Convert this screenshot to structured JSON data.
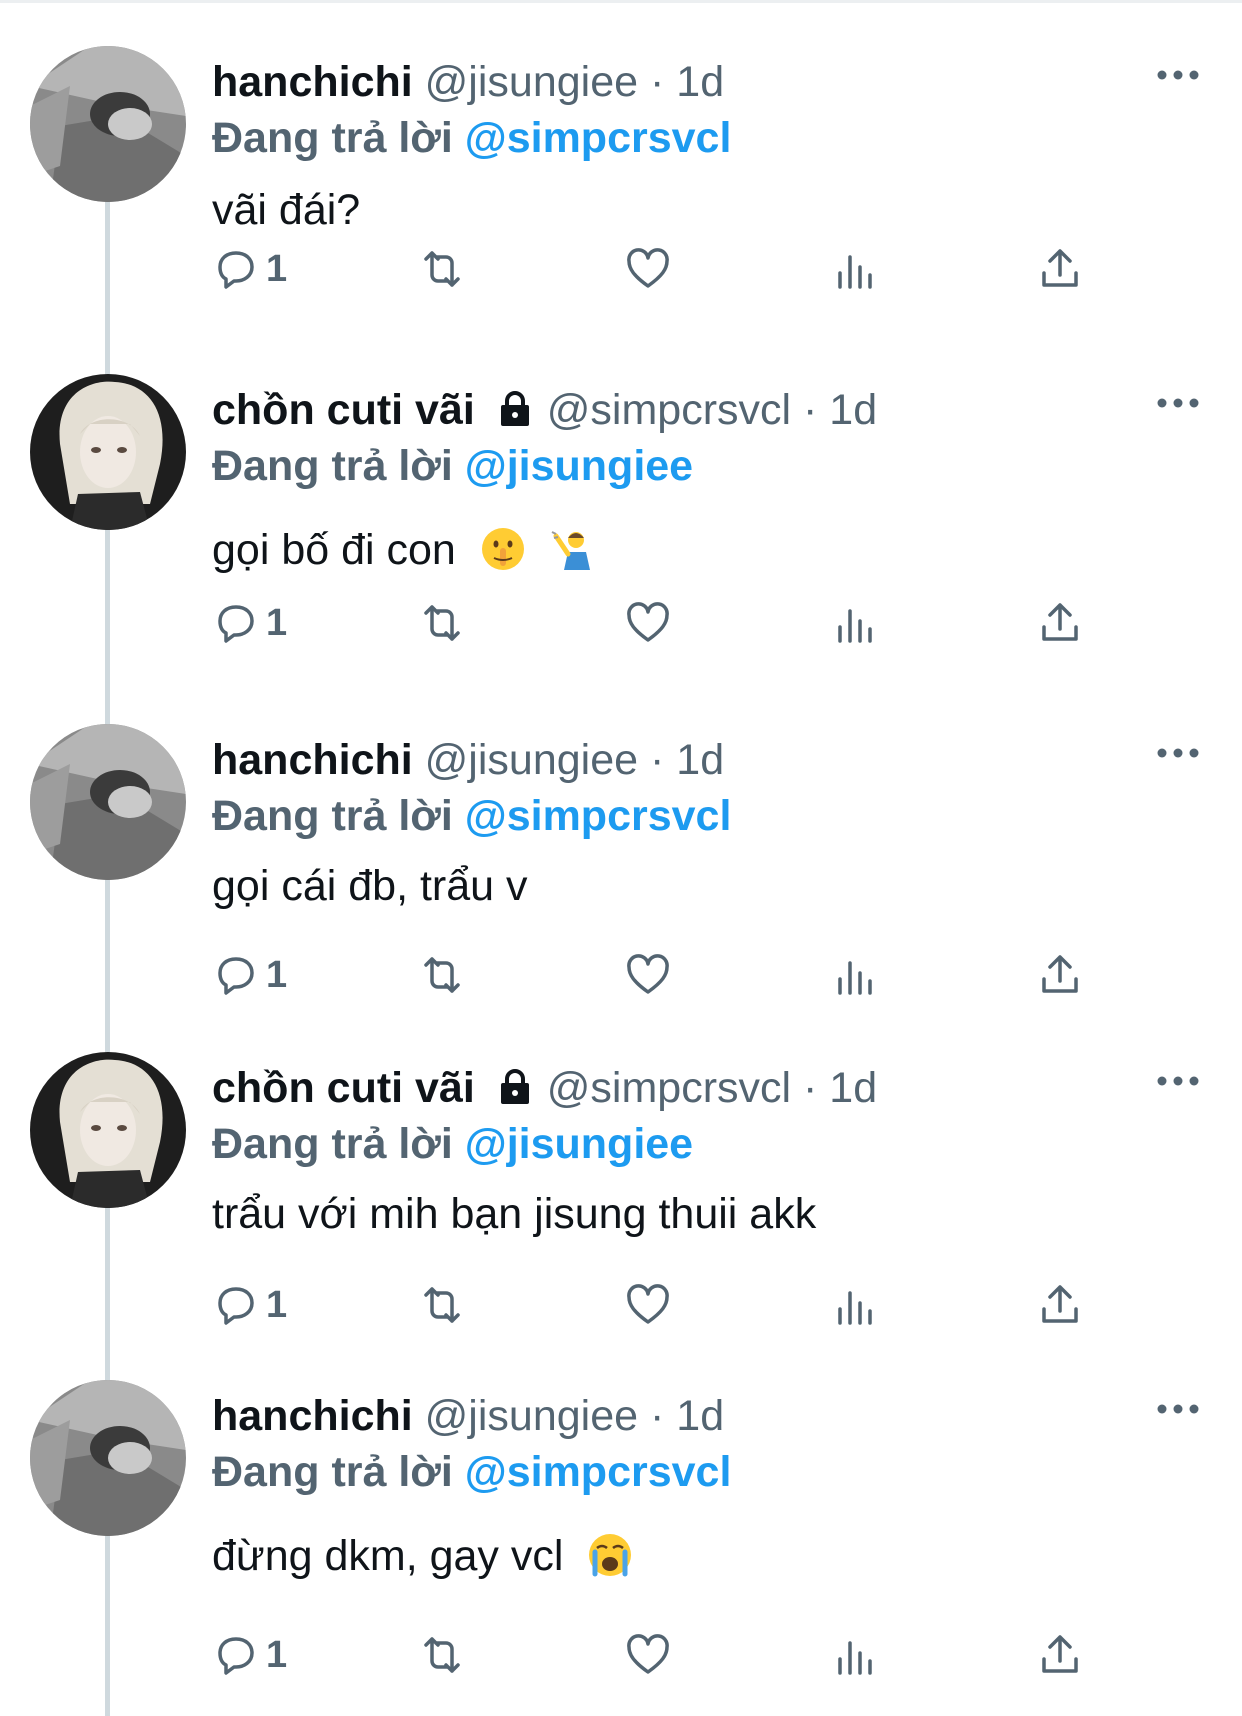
{
  "colors": {
    "accent": "#1d9bf0",
    "secondary_text": "#536471",
    "thread_line": "#cfd9de"
  },
  "icons": {
    "reply": "reply-icon",
    "retweet": "retweet-icon",
    "like": "heart-icon",
    "views": "analytics-icon",
    "share": "share-icon",
    "more": "more-icon",
    "lock": "lock-icon"
  },
  "tweets": [
    {
      "name": "hanchichi",
      "handle": "@jisungiee",
      "dot": "·",
      "time": "1d",
      "replying_prefix": "Đang trả lời",
      "replying_to": "@simpcrsvcl",
      "text": "vãi đái?",
      "reply_count": "1",
      "locked": false,
      "avatar": "a",
      "emoji": []
    },
    {
      "name": "chồn cuti vãi",
      "handle": "@simpcrsvcl",
      "dot": "·",
      "time": "1d",
      "replying_prefix": "Đang trả lời",
      "replying_to": "@jisungiee",
      "text": "gọi bố đi con",
      "reply_count": "1",
      "locked": true,
      "avatar": "b",
      "emoji": [
        "shushing-face-emoji",
        "person-gesturing-emoji"
      ]
    },
    {
      "name": "hanchichi",
      "handle": "@jisungiee",
      "dot": "·",
      "time": "1d",
      "replying_prefix": "Đang trả lời",
      "replying_to": "@simpcrsvcl",
      "text": "gọi cái đb, trẩu v",
      "reply_count": "1",
      "locked": false,
      "avatar": "a",
      "emoji": []
    },
    {
      "name": "chồn cuti vãi",
      "handle": "@simpcrsvcl",
      "dot": "·",
      "time": "1d",
      "replying_prefix": "Đang trả lời",
      "replying_to": "@jisungiee",
      "text": "trẩu với mih bạn jisung thuii akk",
      "reply_count": "1",
      "locked": true,
      "avatar": "b",
      "emoji": []
    },
    {
      "name": "hanchichi",
      "handle": "@jisungiee",
      "dot": "·",
      "time": "1d",
      "replying_prefix": "Đang trả lời",
      "replying_to": "@simpcrsvcl",
      "text": "đừng dkm, gay vcl",
      "reply_count": "1",
      "locked": false,
      "avatar": "a",
      "emoji": [
        "loudly-crying-face-emoji"
      ]
    }
  ]
}
